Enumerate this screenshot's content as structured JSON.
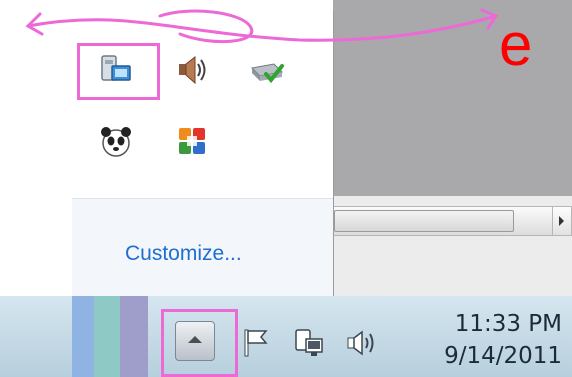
{
  "tray_popup": {
    "customize_label": "Customize...",
    "icons": [
      {
        "name": "network-connection-icon"
      },
      {
        "name": "volume-icon"
      },
      {
        "name": "safely-remove-hardware-icon"
      },
      {
        "name": "panda-antivirus-icon"
      },
      {
        "name": "office-icon"
      }
    ]
  },
  "taskbar": {
    "show_hidden_icons": "show-hidden-icons-button",
    "tray_icons": [
      "action-center-flag-icon",
      "network-icon",
      "volume-icon"
    ],
    "clock": {
      "time": "11:33 PM",
      "date": "9/14/2011"
    }
  },
  "annotation": {
    "letter": "e",
    "color": "#ff0000",
    "stroke_color": "#ec6ad6"
  }
}
